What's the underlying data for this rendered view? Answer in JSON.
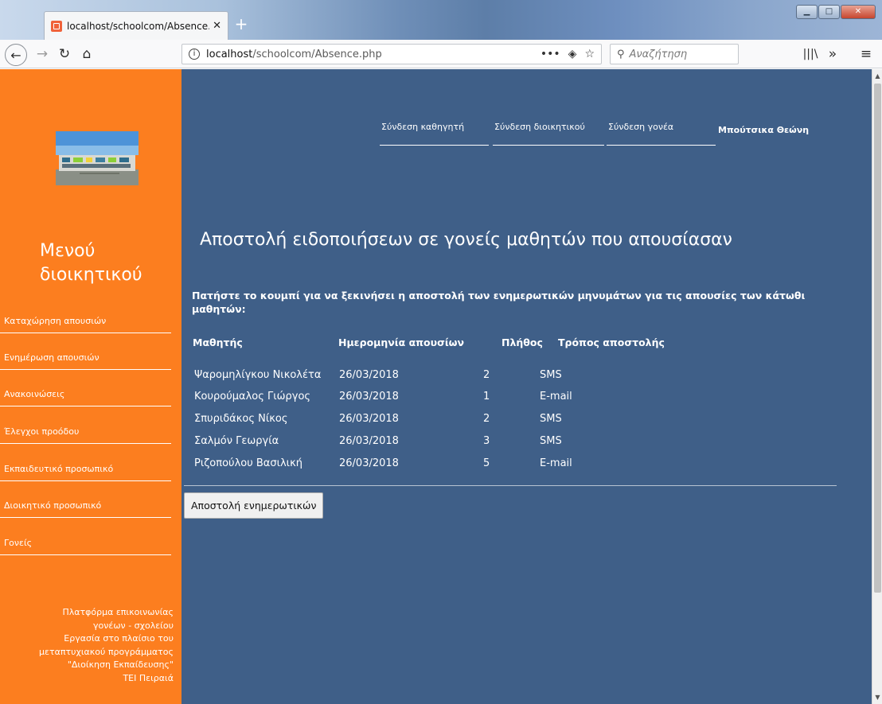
{
  "browser": {
    "tab_title": "localhost/schoolcom/Absence.",
    "url_host": "localhost",
    "url_path": "/schoolcom/Absence.php",
    "search_placeholder": "Αναζήτηση",
    "menu_dots": "•••"
  },
  "sidebar": {
    "menu_title": "Μενού διοικητικού",
    "items": [
      {
        "label": "Καταχώρηση απουσιών"
      },
      {
        "label": "Ενημέρωση απουσιών"
      },
      {
        "label": "Ανακοινώσεις"
      },
      {
        "label": "Έλεγχοι προόδου"
      },
      {
        "label": "Εκπαιδευτικό προσωπικό"
      },
      {
        "label": "Διοικητικό προσωπικό"
      },
      {
        "label": "Γονείς"
      }
    ],
    "footer_lines": [
      "Πλατφόρμα επικοινωνίας",
      "γονέων - σχολείου",
      "Εργασία στο πλαίσιο του",
      "μεταπτυχιακού προγράμματος",
      "\"Διοίκηση Εκπαίδευσης\"",
      "ΤΕΙ Πειραιά"
    ]
  },
  "topnav": {
    "teacher_login": "Σύνδεση καθηγητή",
    "admin_login": "Σύνδεση διοικητικού",
    "parent_login": "Σύνδεση γονέα",
    "user_name": "Μπούτσικα Θεώνη"
  },
  "main": {
    "heading": "Αποστολή ειδοποιήσεων σε γονείς μαθητών που απουσίασαν",
    "instructions": "Πατήστε το κουμπί για να ξεκινήσει η αποστολή των ενημερωτικών μηνυμάτων για τις απουσίες των κάτωθι μαθητών:",
    "table": {
      "headers": [
        "Μαθητής",
        "Ημερομηνία απουσίων",
        "Πλήθος",
        "Τρόπος αποστολής"
      ],
      "rows": [
        [
          "Ψαρομηλίγκου Νικολέτα",
          "26/03/2018",
          "2",
          "SMS"
        ],
        [
          "Κουρούμαλος Γιώργος",
          "26/03/2018",
          "1",
          "E-mail"
        ],
        [
          "Σπυριδάκος Νίκος",
          "26/03/2018",
          "2",
          "SMS"
        ],
        [
          "Σαλμόν Γεωργία",
          "26/03/2018",
          "3",
          "SMS"
        ],
        [
          "Ριζοπούλου Βασιλική",
          "26/03/2018",
          "5",
          "E-mail"
        ]
      ]
    },
    "send_button": "Αποστολή ενημερωτικών"
  }
}
